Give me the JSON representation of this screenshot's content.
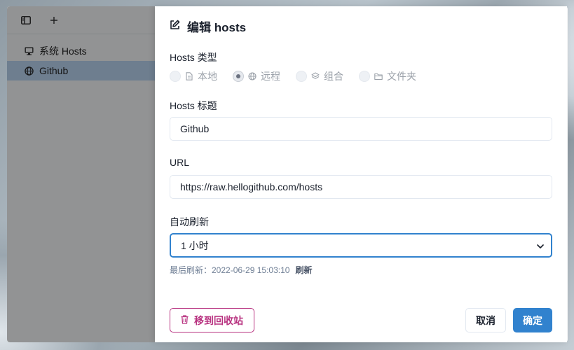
{
  "sidebar": {
    "items": [
      {
        "label": "系统 Hosts",
        "icon": "monitor-icon"
      },
      {
        "label": "Github",
        "icon": "globe-icon",
        "selected": true
      }
    ]
  },
  "dialog": {
    "title": "编辑 hosts",
    "type_label": "Hosts 类型",
    "types": [
      {
        "label": "本地",
        "icon": "file-icon",
        "checked": false
      },
      {
        "label": "远程",
        "icon": "globe-icon",
        "checked": true
      },
      {
        "label": "组合",
        "icon": "layers-icon",
        "checked": false
      },
      {
        "label": "文件夹",
        "icon": "folder-icon",
        "checked": false
      }
    ],
    "title_label": "Hosts 标题",
    "title_value": "Github",
    "url_label": "URL",
    "url_value": "https://raw.hellogithub.com/hosts",
    "refresh_label": "自动刷新",
    "refresh_value": "1 小时",
    "last_refresh_label": "最后刷新：2022-06-29 15:03:10",
    "refresh_link": "刷新",
    "trash_button": "移到回收站",
    "cancel_button": "取消",
    "ok_button": "确定"
  },
  "colors": {
    "accent": "#3182ce",
    "danger": "#b83280",
    "selected_row": "#b8d2ef"
  }
}
